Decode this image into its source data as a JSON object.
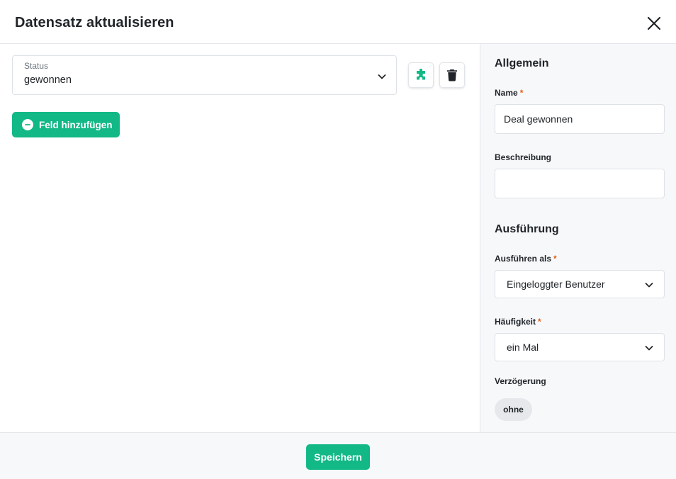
{
  "dialog": {
    "title": "Datensatz aktualisieren"
  },
  "fields": {
    "status": {
      "label": "Status",
      "value": "gewonnen"
    },
    "add_field_label": "Feld hinzufügen"
  },
  "sidebar": {
    "general_title": "Allgemein",
    "name_label": "Name",
    "name_value": "Deal gewonnen",
    "description_label": "Beschreibung",
    "description_value": "",
    "execution_title": "Ausführung",
    "run_as_label": "Ausführen als",
    "run_as_value": "Eingeloggter Benutzer",
    "frequency_label": "Häufigkeit",
    "frequency_value": "ein Mal",
    "delay_label": "Verzögerung",
    "delay_value": "ohne",
    "required_marker": "*"
  },
  "footer": {
    "save_label": "Speichern"
  },
  "colors": {
    "accent": "#12b886",
    "required": "#e8590c"
  }
}
